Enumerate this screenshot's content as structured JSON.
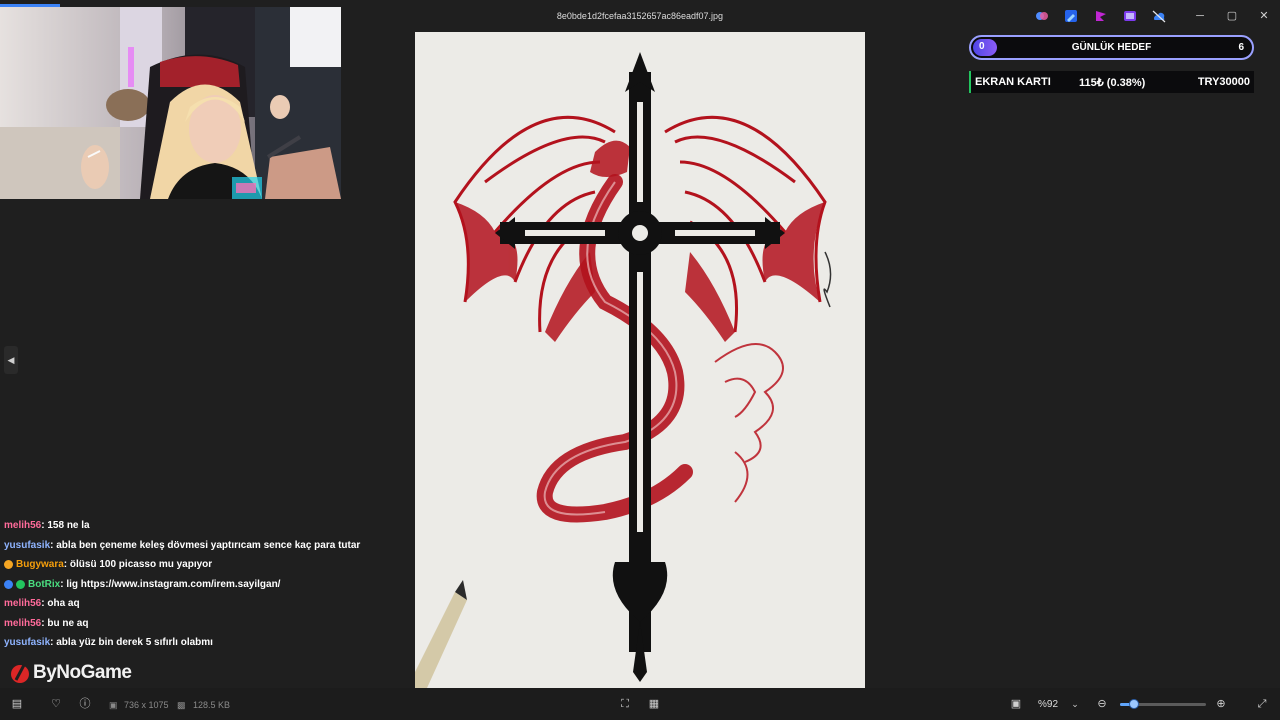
{
  "window": {
    "file_title": "8e0bde1d2fcefaa3152657ac86eadf07.jpg",
    "controls": {
      "minimize": "─",
      "maximize": "▢",
      "close": "✕"
    }
  },
  "overlay": {
    "goal": {
      "current": "0",
      "label": "GÜNLÜK HEDEF",
      "target": "6",
      "progress_fraction": 0
    },
    "ticker": {
      "name": "EKRAN KARTI",
      "change": "115₺ (0.38%)",
      "value": "TRY30000"
    }
  },
  "chat": {
    "messages": [
      {
        "user": "melih56",
        "text": " : 158 ne la",
        "color": "#ff6b9a",
        "badges": []
      },
      {
        "user": "yusufasik",
        "text": " : abla ben çeneme keleş dövmesi yaptırıcam sence kaç para tutar",
        "color": "#8fb4ff",
        "badges": []
      },
      {
        "user": "Bugywara",
        "text": " : ölüsü 100 picasso mu yapıyor",
        "color": "#f59e0b",
        "badges": [
          "#f5a623"
        ]
      },
      {
        "user": "BotRix",
        "text": " : lig https://www.instagram.com/irem.sayilgan/",
        "color": "#4ade80",
        "badges": [
          "#3b82f6",
          "#22c55e"
        ]
      },
      {
        "user": "melih56",
        "text": " : oha aq",
        "color": "#ff6b9a",
        "badges": []
      },
      {
        "user": "melih56",
        "text": " : bu ne aq",
        "color": "#ff6b9a",
        "badges": []
      },
      {
        "user": "yusufasik",
        "text": " : abla yüz bin derek 5 sıfırlı olabmı",
        "color": "#8fb4ff",
        "badges": []
      }
    ],
    "brand": "ByNoGame"
  },
  "statusbar": {
    "dimensions": "736 x 1075",
    "file_size": "128.5 KB",
    "zoom": "%92",
    "zoom_fraction": 0.16
  },
  "colors": {
    "accent": "#60a5fa",
    "dragon_red": "#b3121d",
    "ink": "#111111"
  }
}
